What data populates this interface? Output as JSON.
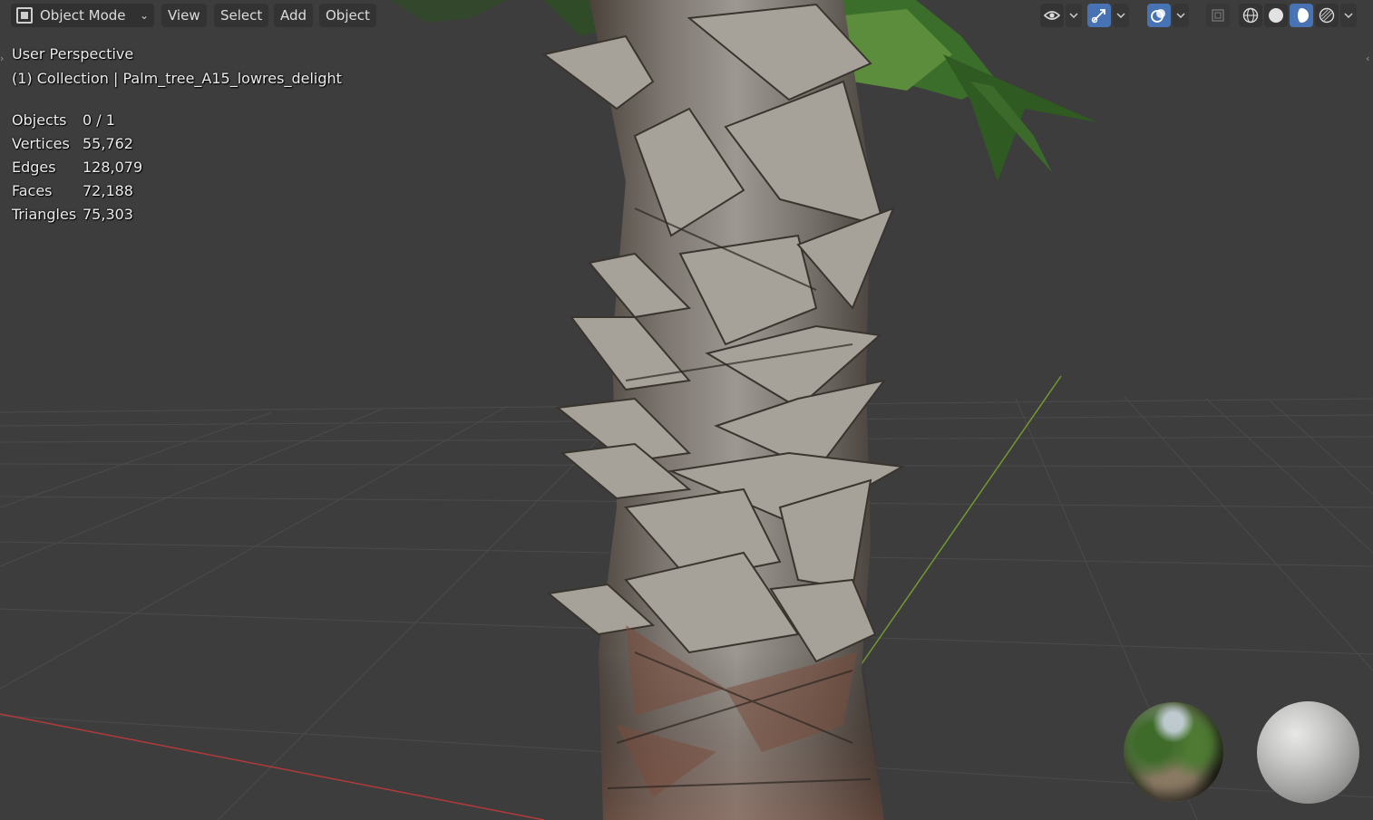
{
  "header": {
    "mode_label": "Object Mode",
    "menus": [
      "View",
      "Select",
      "Add",
      "Object"
    ],
    "icons": {
      "visibility": "eye-icon",
      "gizmo": "gizmo-icon",
      "overlays": "overlays-icon",
      "xray": "xray-icon",
      "shading_wireframe": "wireframe-shading-icon",
      "shading_solid": "solid-shading-icon",
      "shading_material": "material-preview-icon",
      "shading_rendered": "rendered-shading-icon"
    },
    "active_shading": "material-preview"
  },
  "viewport": {
    "view_name": "User Perspective",
    "collection_info": "(1) Collection | Palm_tree_A15_lowres_delight"
  },
  "stats": [
    {
      "label": "Objects",
      "value": "0 / 1"
    },
    {
      "label": "Vertices",
      "value": "55,762"
    },
    {
      "label": "Edges",
      "value": "128,079"
    },
    {
      "label": "Faces",
      "value": "72,188"
    },
    {
      "label": "Triangles",
      "value": "75,303"
    }
  ],
  "colors": {
    "background": "#3d3d3d",
    "grid": "#4b4b4b",
    "x_axis": "#b23a3a",
    "y_axis": "#6f9a2e",
    "accent": "#4772b3"
  }
}
